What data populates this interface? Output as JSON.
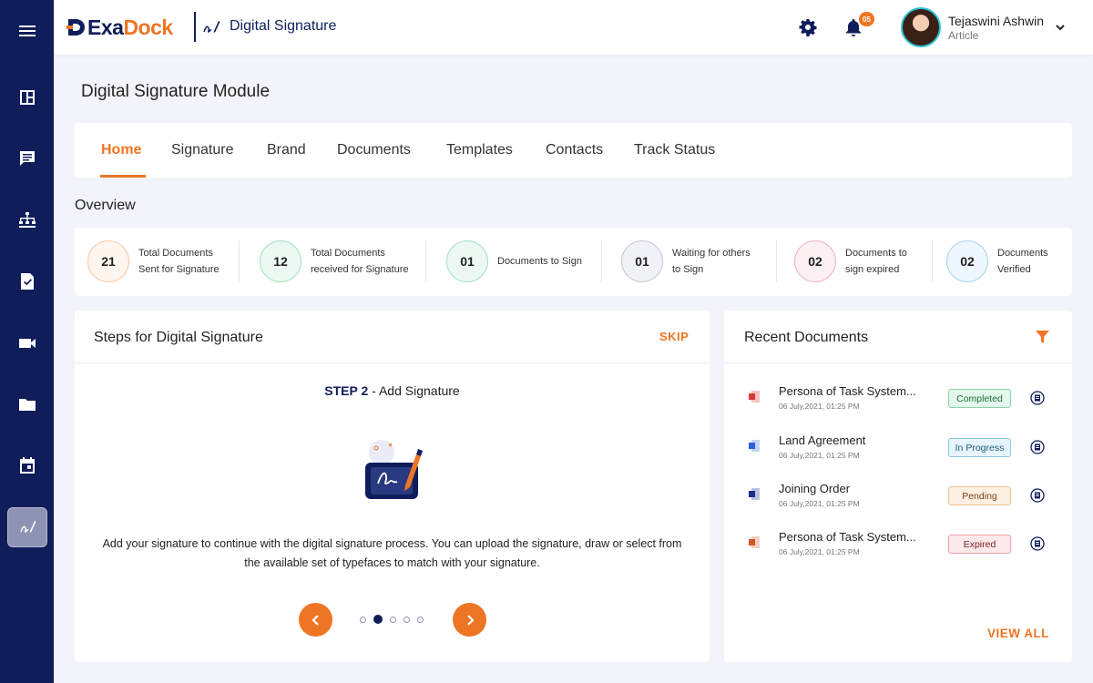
{
  "app": {
    "brand_exa": "Exa",
    "brand_dock": "Dock",
    "module": "Digital Signature"
  },
  "header": {
    "notification_count": "05",
    "user_name": "Tejaswini Ashwin",
    "user_role": "Article"
  },
  "sidebar": {
    "items": [
      {
        "icon": "dashboard-icon"
      },
      {
        "icon": "chat-icon"
      },
      {
        "icon": "hierarchy-icon"
      },
      {
        "icon": "document-check-icon"
      },
      {
        "icon": "video-icon"
      },
      {
        "icon": "folder-icon"
      },
      {
        "icon": "calendar-icon"
      },
      {
        "icon": "signature-icon",
        "active": true
      }
    ]
  },
  "page": {
    "title": "Digital Signature Module"
  },
  "tabs": [
    {
      "label": "Home",
      "active": true
    },
    {
      "label": "Signature"
    },
    {
      "label": "Brand"
    },
    {
      "label": "Documents"
    },
    {
      "label": "Templates"
    },
    {
      "label": "Contacts"
    },
    {
      "label": "Track Status"
    }
  ],
  "overview": {
    "title": "Overview",
    "stats": [
      {
        "value": "21",
        "label": "Total Documents\nSent for Signature",
        "color": "#ee7524"
      },
      {
        "value": "12",
        "label": "Total Documents\nreceived for Signature",
        "color": "#2fb98a"
      },
      {
        "value": "01",
        "label": "Documents to Sign",
        "color": "#2fb98a"
      },
      {
        "value": "01",
        "label": "Waiting for others\nto Sign",
        "color": "#8e93b4"
      },
      {
        "value": "02",
        "label": "Documents to\nsign expired",
        "color": "#e8536a"
      },
      {
        "value": "02",
        "label": "Documents\nVerified",
        "color": "#3aa3d8"
      }
    ]
  },
  "steps": {
    "title": "Steps for Digital Signature",
    "skip": "SKIP",
    "step_num": "STEP 2",
    "step_label": " - Add Signature",
    "description": "Add your signature to continue with the digital signature process. You can upload the signature, draw or select from the available set of typefaces to match with your signature.",
    "current_step": 2,
    "total_steps": 5
  },
  "recent": {
    "title": "Recent Documents",
    "view_all": "VIEW ALL",
    "documents": [
      {
        "name": "Persona of Task System...",
        "date": "06 July,2021, 01:25 PM",
        "status": "Completed",
        "type": "pdf-icon"
      },
      {
        "name": "Land Agreement",
        "date": "06 July,2021, 01:25 PM",
        "status": "In Progress",
        "type": "word-icon"
      },
      {
        "name": "Joining Order",
        "date": "06 July,2021, 01:25 PM",
        "status": "Pending",
        "type": "word-icon"
      },
      {
        "name": "Persona of Task System...",
        "date": "06 July,2021, 01:25 PM",
        "status": "Expired",
        "type": "powerpoint-icon"
      }
    ]
  },
  "colors": {
    "accent": "#ee7524",
    "navy": "#0f1d5b"
  }
}
